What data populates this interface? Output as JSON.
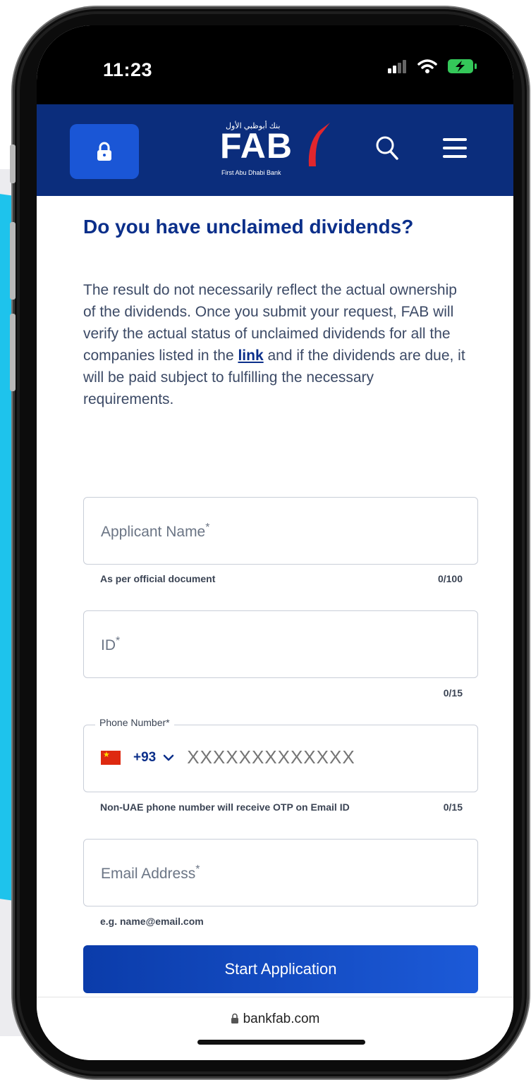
{
  "status_bar": {
    "time": "11:23"
  },
  "header": {
    "logo_text": "FAB",
    "logo_arabic": "بنك أبوظبي الأول",
    "logo_subtitle": "First Abu Dhabi Bank",
    "brand_color": "#0b2d7c",
    "accent_color": "#e1262d"
  },
  "main": {
    "title": "Do you have unclaimed dividends?",
    "description_before_link": "The result do not necessarily reflect the actual ownership of the dividends. Once you submit your request, FAB will verify the actual status of unclaimed dividends for all the companies listed in the ",
    "link_text": "link",
    "description_after_link": " and if the dividends are due, it will be paid subject to fulfilling the necessary requirements."
  },
  "form": {
    "applicant_name": {
      "label": "Applicant Name",
      "required_mark": "*",
      "helper": "As per official document",
      "counter": "0/100"
    },
    "id_field": {
      "label": "ID",
      "required_mark": "*",
      "counter": "0/15"
    },
    "phone": {
      "label": "Phone Number",
      "required_mark": "*",
      "country_code": "+93",
      "placeholder": "XXXXXXXXXXXXX",
      "helper": "Non-UAE phone number will receive OTP on Email ID",
      "counter": "0/15"
    },
    "email": {
      "label": "Email Address",
      "required_mark": "*",
      "helper": "e.g. name@email.com"
    },
    "submit_label": "Start Application"
  },
  "browser": {
    "url": "bankfab.com"
  }
}
